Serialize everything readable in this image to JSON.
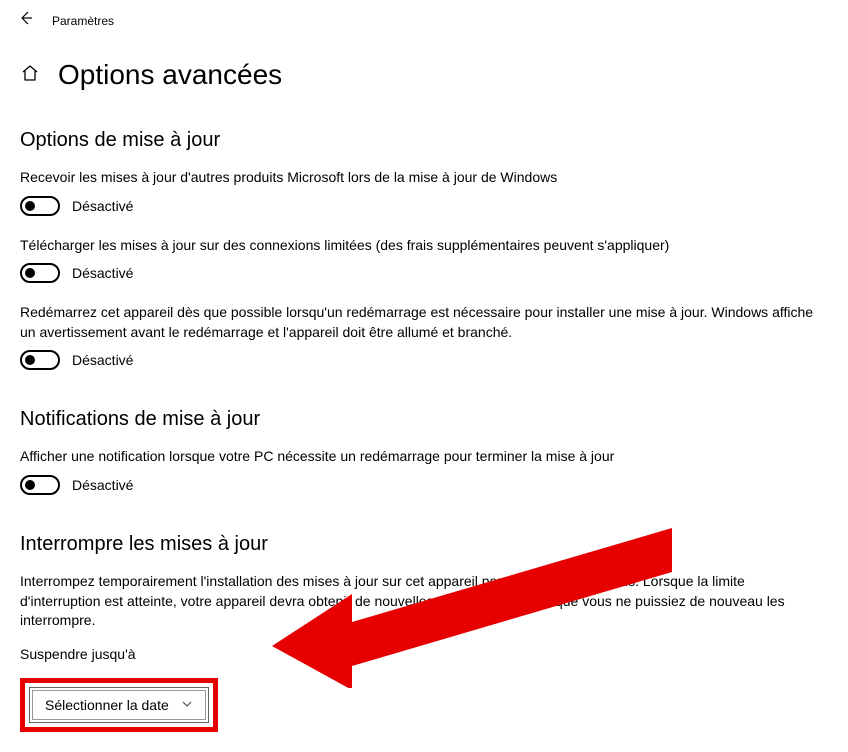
{
  "header": {
    "title": "Paramètres"
  },
  "page": {
    "title": "Options avancées"
  },
  "sections": {
    "updateOptions": {
      "heading": "Options de mise à jour",
      "opt1": {
        "text": "Recevoir les mises à jour d'autres produits Microsoft lors de la mise à jour de Windows",
        "state": "Désactivé"
      },
      "opt2": {
        "text": "Télécharger les mises à jour sur des connexions limitées (des frais supplémentaires peuvent s'appliquer)",
        "state": "Désactivé"
      },
      "opt3": {
        "text": "Redémarrez cet appareil dès que possible lorsqu'un redémarrage est nécessaire pour installer une mise à jour. Windows affiche un avertissement avant le redémarrage et l'appareil doit être allumé et branché.",
        "state": "Désactivé"
      }
    },
    "updateNotifications": {
      "heading": "Notifications de mise à jour",
      "opt1": {
        "text": "Afficher une notification lorsque votre PC nécessite un redémarrage pour terminer la mise à jour",
        "state": "Désactivé"
      }
    },
    "pauseUpdates": {
      "heading": "Interrompre les mises à jour",
      "text": "Interrompez temporairement l'installation des mises à jour sur cet appareil pendant 35 jours au plus. Lorsque la limite d'interruption est atteinte, votre appareil devra obtenir de nouvelles mises à jour avant que vous ne puissiez de nouveau les interrompre.",
      "label": "Suspendre jusqu'à",
      "selectLabel": "Sélectionner la date"
    }
  }
}
